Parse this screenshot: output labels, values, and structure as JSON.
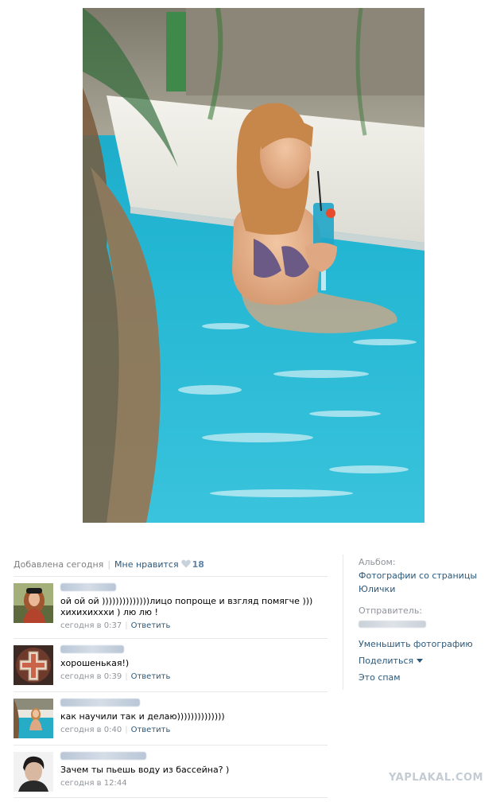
{
  "photo": {
    "alt": "pool photo"
  },
  "meta": {
    "added": "Добавлена сегодня",
    "like_label": "Мне нравится",
    "like_count": "18"
  },
  "comments": [
    {
      "text": "ой ой ой ))))))))))))))лицо попроще и взгляд помягче )))\nхихихихххи ) лю лю !",
      "time": "сегодня в 0:37",
      "reply": "Ответить"
    },
    {
      "text": "хорошенькая!)",
      "time": "сегодня в 0:39",
      "reply": "Ответить"
    },
    {
      "text": "как научили так и делаю))))))))))))))",
      "time": "сегодня в 0:40",
      "reply": "Ответить"
    },
    {
      "text": "Зачем ты пьешь воду из бассейна? )",
      "time": "сегодня в 12:44",
      "reply": ""
    }
  ],
  "sidebar": {
    "album_label": "Альбом:",
    "album_line1": "Фотографии со страницы",
    "album_line2": "Юлички",
    "sender_label": "Отправитель:",
    "reduce": "Уменьшить фотографию",
    "share": "Поделиться",
    "spam": "Это спам"
  },
  "watermark": "YAPLAKAL.COM"
}
